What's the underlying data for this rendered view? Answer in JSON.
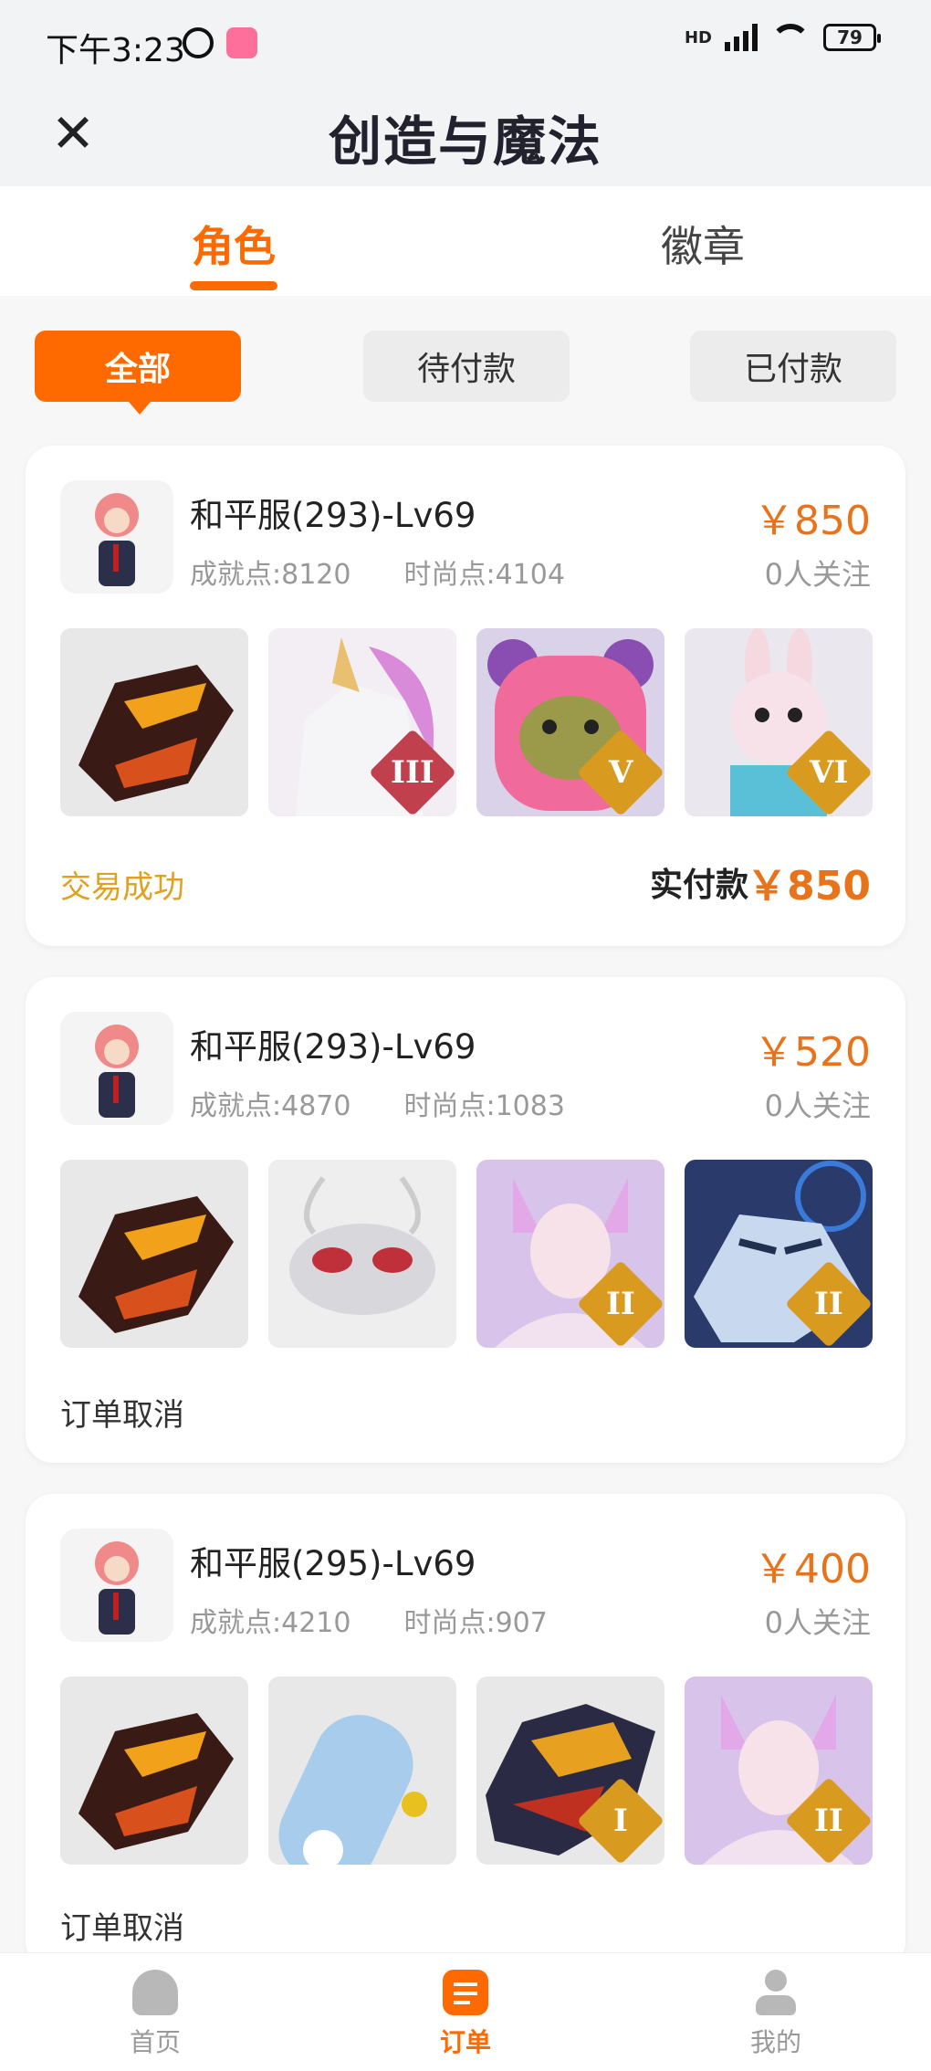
{
  "status_bar": {
    "time": "下午3:23",
    "network": "HD",
    "battery": "79"
  },
  "header": {
    "title": "创造与魔法",
    "close_icon": "close-icon"
  },
  "tabs": [
    {
      "label": "角色",
      "active": true
    },
    {
      "label": "徽章",
      "active": false
    }
  ],
  "filters": [
    {
      "label": "全部",
      "active": true
    },
    {
      "label": "待付款",
      "active": false
    },
    {
      "label": "已付款",
      "active": false
    }
  ],
  "colors": {
    "accent": "#ff6a00",
    "price": "#e8731a",
    "success": "#e0a020"
  },
  "orders": [
    {
      "title": "和平服(293)-Lv69",
      "achievement": "成就点:8120",
      "fashion": "时尚点:4104",
      "price": "￥850",
      "followers": "0人关注",
      "items": [
        {
          "name": "dragon-mount",
          "badge": ""
        },
        {
          "name": "unicorn-mount",
          "badge": "III"
        },
        {
          "name": "pink-bear",
          "badge": "V"
        },
        {
          "name": "bunny-pet",
          "badge": "VI"
        }
      ],
      "status": "交易成功",
      "paid_label": "实付款",
      "paid_value": "￥850"
    },
    {
      "title": "和平服(293)-Lv69",
      "achievement": "成就点:4870",
      "fashion": "时尚点:1083",
      "price": "￥520",
      "followers": "0人关注",
      "items": [
        {
          "name": "dragon-mount",
          "badge": ""
        },
        {
          "name": "mecha-bug",
          "badge": ""
        },
        {
          "name": "fox-spirit",
          "badge": "II"
        },
        {
          "name": "ice-tiger",
          "badge": "II"
        }
      ],
      "status": "订单取消"
    },
    {
      "title": "和平服(295)-Lv69",
      "achievement": "成就点:4210",
      "fashion": "时尚点:907",
      "price": "￥400",
      "followers": "0人关注",
      "items": [
        {
          "name": "dragon-mount",
          "badge": ""
        },
        {
          "name": "skateboard",
          "badge": ""
        },
        {
          "name": "fire-dragon",
          "badge": "I"
        },
        {
          "name": "fox-spirit",
          "badge": "II"
        }
      ],
      "status": "订单取消"
    }
  ],
  "bottom_nav": [
    {
      "label": "首页",
      "icon": "home-icon",
      "active": false
    },
    {
      "label": "订单",
      "icon": "order-icon",
      "active": true
    },
    {
      "label": "我的",
      "icon": "profile-icon",
      "active": false
    }
  ]
}
